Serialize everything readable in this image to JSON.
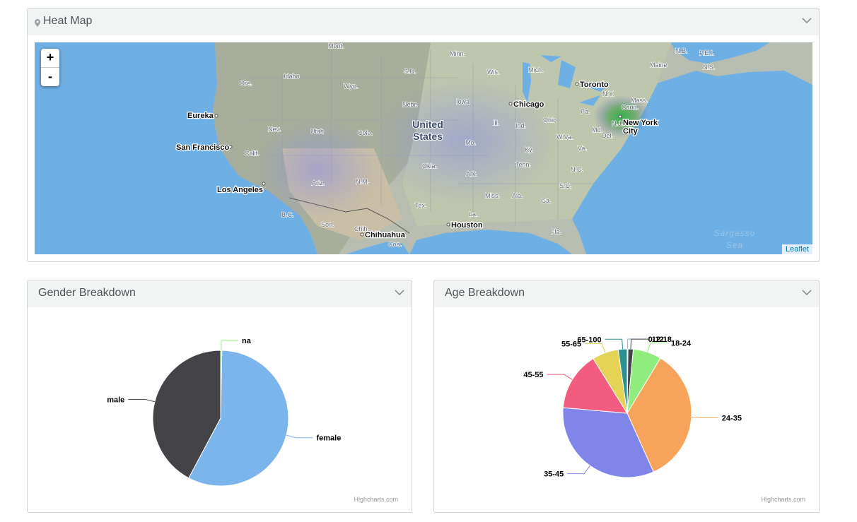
{
  "heatmap": {
    "title": "Heat Map",
    "zoom_in": "+",
    "zoom_out": "-",
    "attribution": "Leaflet",
    "labels": {
      "cities": [
        "Eureka",
        "San Francisco",
        "Los Angeles",
        "Chicago",
        "Toronto",
        "Houston",
        "Chihuahua",
        "New York",
        "City"
      ],
      "country": [
        "United",
        "States"
      ],
      "regions": [
        "Mont.",
        "Minn.",
        "S.D.",
        "Wis.",
        "Mich.",
        "Maine",
        "N.B.",
        "P.E.I.",
        "N.S.",
        "Idaho",
        "Ore.",
        "Wyo.",
        "Nebr.",
        "Iowa",
        "N.Y.",
        "Mass.",
        "Conn.",
        "Nev.",
        "Utah",
        "Colo.",
        "Ill.",
        "Ind.",
        "Ohio",
        "Pa.",
        "Md.",
        "Del.",
        "N.J.",
        "Calif.",
        "Mo.",
        "Ky.",
        "W.Va.",
        "Va.",
        "Okla.",
        "Ark.",
        "Tenn.",
        "N.C.",
        "Ariz.",
        "N.M.",
        "Miss.",
        "Ala.",
        "S.C.",
        "Ga.",
        "Tex.",
        "La.",
        "Fla.",
        "B.C.",
        "Son.",
        "Chih.",
        "Coa."
      ],
      "sea": [
        "Sargasso",
        "Sea"
      ]
    }
  },
  "gender": {
    "title": "Gender Breakdown",
    "credit": "Highcharts.com",
    "chart_data": {
      "type": "pie",
      "categories": [
        "na",
        "female",
        "male"
      ],
      "values": [
        0.3,
        57.5,
        42.2
      ],
      "colors": [
        "#90ed7d",
        "#7cb5ec",
        "#434348"
      ]
    }
  },
  "age": {
    "title": "Age Breakdown",
    "credit": "Highcharts.com",
    "chart_data": {
      "type": "pie",
      "categories": [
        "0-12",
        "12-18",
        "18-24",
        "24-35",
        "35-45",
        "45-55",
        "55-65",
        "65-100"
      ],
      "values": [
        0.2,
        1.3,
        7.0,
        34.0,
        32.5,
        14.5,
        6.5,
        2.2
      ],
      "colors": [
        "#7cb5ec",
        "#434348",
        "#90ed7d",
        "#f7a35c",
        "#8085e9",
        "#f15c80",
        "#e4d354",
        "#2b908f"
      ]
    }
  }
}
